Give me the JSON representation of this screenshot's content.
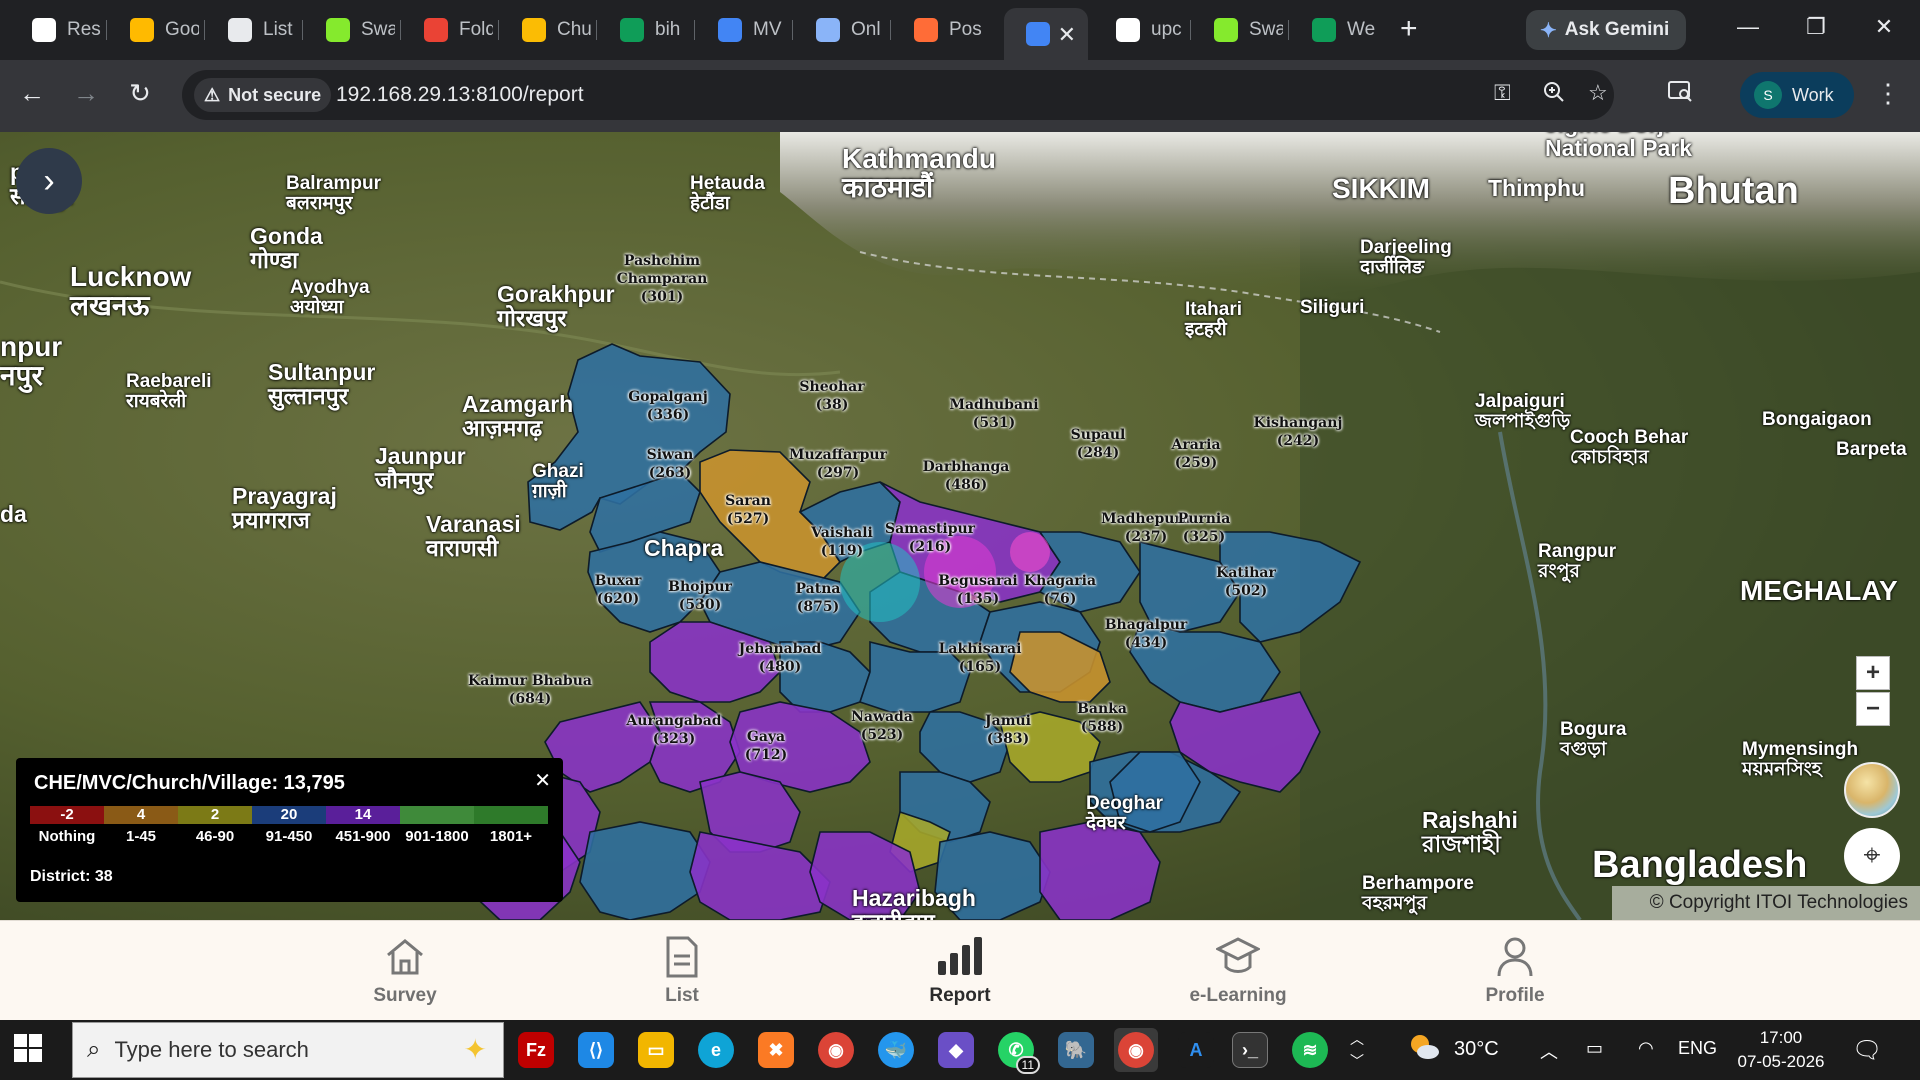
{
  "browser": {
    "tabs": [
      {
        "title": "Res",
        "icon": "openai-icon",
        "color": "#ffffff"
      },
      {
        "title": "Goo",
        "icon": "google-meet-icon",
        "color": "#ffba00"
      },
      {
        "title": "List",
        "icon": "list-app-icon",
        "color": "#e8eaed"
      },
      {
        "title": "Swa",
        "icon": "swagger-icon",
        "color": "#85ea2d"
      },
      {
        "title": "Fold",
        "icon": "gmail-icon",
        "color": "#ea4335"
      },
      {
        "title": "Chu",
        "icon": "google-drive-icon",
        "color": "#fbbc04"
      },
      {
        "title": "bih",
        "icon": "google-sheets-icon",
        "color": "#0f9d58"
      },
      {
        "title": "MV",
        "icon": "app-icon",
        "color": "#4285f4"
      },
      {
        "title": "Onl",
        "icon": "globe-icon",
        "color": "#8ab4f8"
      },
      {
        "title": "Pos",
        "icon": "postman-icon",
        "color": "#ff6c37"
      },
      {
        "title": "",
        "icon": "app-icon",
        "color": "#4285f4",
        "active": true
      },
      {
        "title": "upc",
        "icon": "github-icon",
        "color": "#ffffff"
      },
      {
        "title": "Swa",
        "icon": "swagger-icon",
        "color": "#85ea2d"
      },
      {
        "title": "We",
        "icon": "google-sheets-icon",
        "color": "#0f9d58"
      }
    ],
    "ask_gemini": "Ask Gemini",
    "not_secure": "Not secure",
    "url": "192.168.29.13:8100/report",
    "profile_initial": "S",
    "profile_label": "Work"
  },
  "map": {
    "basemap_labels": [
      {
        "text": "Kathmandu\nकाठमाडौं",
        "size": "large"
      },
      {
        "text": "Hetauda\nहेटौंडा",
        "size": "small"
      },
      {
        "text": "Balrampur\nबलरामपुर",
        "size": "small"
      },
      {
        "text": "Gonda\nगोण्डा",
        "size": "medium"
      },
      {
        "text": "Lucknow\nलखनऊ",
        "size": "large"
      },
      {
        "text": "Ayodhya\nअयोध्या",
        "size": "small"
      },
      {
        "text": "Gorakhpur\nगोरखपुर",
        "size": "medium"
      },
      {
        "text": "Raebareli\nरायबरेली",
        "size": "small"
      },
      {
        "text": "Sultanpur\nसुल्तानपुर",
        "size": "medium"
      },
      {
        "text": "Azamgarh\nआज़मगढ़",
        "size": "medium"
      },
      {
        "text": "Jaunpur\nजौनपुर",
        "size": "medium"
      },
      {
        "text": "Prayagraj\nप्रयागराज",
        "size": "medium"
      },
      {
        "text": "Varanasi\nवाराणसी",
        "size": "medium"
      },
      {
        "text": "Ghazi\nग़ाज़ी",
        "size": "small"
      },
      {
        "text": "SIKKIM",
        "size": "large"
      },
      {
        "text": "Thimphu",
        "size": "medium"
      },
      {
        "text": "Bhutan",
        "size": "xlarge"
      },
      {
        "text": "Jigme Dorji\nNational Park",
        "size": "medium"
      },
      {
        "text": "Darjeeling\nदार्जीलिङ",
        "size": "small"
      },
      {
        "text": "Itahari\nइटहरी",
        "size": "small"
      },
      {
        "text": "Siliguri",
        "size": "small"
      },
      {
        "text": "Jalpaiguri\nজলপাইগুড়ি",
        "size": "small"
      },
      {
        "text": "Cooch Behar\nকোচবিহার",
        "size": "small"
      },
      {
        "text": "Bongaigaon",
        "size": "small"
      },
      {
        "text": "Barpeta",
        "size": "small"
      },
      {
        "text": "Rangpur\nরংপুর",
        "size": "small"
      },
      {
        "text": "MEGHALAY",
        "size": "large"
      },
      {
        "text": "Bogura\nবগুড়া",
        "size": "small"
      },
      {
        "text": "Mymensingh\nময়মনসিংহ",
        "size": "small"
      },
      {
        "text": "Rajshahi\nরাজশাহী",
        "size": "medium"
      },
      {
        "text": "Bangladesh",
        "size": "xlarge"
      },
      {
        "text": "Berhampore\nবহরমপুর",
        "size": "small"
      },
      {
        "text": "Deoghar\nदेवघर",
        "size": "small"
      },
      {
        "text": "Hazaribagh\nहज़ारीबाग",
        "size": "medium"
      },
      {
        "text": "Chapra",
        "size": "medium"
      },
      {
        "text": "pur\nसीतापुर",
        "size": "medium"
      },
      {
        "text": "npur\nनपुर",
        "size": "large"
      },
      {
        "text": "da",
        "size": "medium"
      }
    ],
    "districts": [
      {
        "name": "Pashchim\nChamparan",
        "count": "(301)",
        "color": "#2f6fa0"
      },
      {
        "name": "Gopalganj",
        "count": "(336)",
        "color": "#2f6fa0"
      },
      {
        "name": "Sheohar",
        "count": "(38)",
        "color": "#c9932d"
      },
      {
        "name": "Madhubani",
        "count": "(531)",
        "color": "#8a32c8"
      },
      {
        "name": "Supaul",
        "count": "(284)",
        "color": "#2f6fa0"
      },
      {
        "name": "Araria",
        "count": "(259)",
        "color": "#2f6fa0"
      },
      {
        "name": "Kishanganj",
        "count": "(242)",
        "color": "#2f6fa0"
      },
      {
        "name": "Siwan",
        "count": "(263)",
        "color": "#2f6fa0"
      },
      {
        "name": "Muzaffarpur",
        "count": "(297)",
        "color": "#2f6fa0"
      },
      {
        "name": "Darbhanga",
        "count": "(486)",
        "color": "#2f6fa0"
      },
      {
        "name": "Saran",
        "count": "(527)",
        "color": "#8a32c8"
      },
      {
        "name": "Vaishali",
        "count": "(119)",
        "color": "#2f6fa0"
      },
      {
        "name": "Samastipur",
        "count": "(216)",
        "color": "#2f6fa0"
      },
      {
        "name": "Madhepura",
        "count": "(237)",
        "color": "#2f6fa0"
      },
      {
        "name": "Purnia",
        "count": "(325)",
        "color": "#2f6fa0"
      },
      {
        "name": "Katihar",
        "count": "(502)",
        "color": "#8a32c8"
      },
      {
        "name": "Buxar",
        "count": "(620)",
        "color": "#8a32c8"
      },
      {
        "name": "Bhojpur",
        "count": "(530)",
        "color": "#8a32c8"
      },
      {
        "name": "Patna",
        "count": "(875)",
        "color": "#8a32c8"
      },
      {
        "name": "Begusarai",
        "count": "(135)",
        "color": "#2f6fa0"
      },
      {
        "name": "Khagaria",
        "count": "(76)",
        "color": "#a7a82a"
      },
      {
        "name": "Bhagalpur",
        "count": "(434)",
        "color": "#2f6fa0"
      },
      {
        "name": "Jehanabad",
        "count": "(480)",
        "color": "#8a32c8"
      },
      {
        "name": "Lakhisarai",
        "count": "(165)",
        "color": "#2f6fa0"
      },
      {
        "name": "Kaimur Bhabua",
        "count": "(684)",
        "color": "#8a32c8"
      },
      {
        "name": "Aurangabad",
        "count": "(323)",
        "color": "#2f6fa0"
      },
      {
        "name": "Gaya",
        "count": "(712)",
        "color": "#8a32c8"
      },
      {
        "name": "Nawada",
        "count": "(523)",
        "color": "#8a32c8"
      },
      {
        "name": "Jamui",
        "count": "(383)",
        "color": "#2f6fa0"
      },
      {
        "name": "Banka",
        "count": "(588)",
        "color": "#8a32c8"
      }
    ],
    "legend": {
      "title": "CHE/MVC/Church/Village: 13,795",
      "classes": [
        {
          "count": "-2",
          "range": "Nothing",
          "color": "#8b1010"
        },
        {
          "count": "4",
          "range": "1-45",
          "color": "#8a5a16"
        },
        {
          "count": "2",
          "range": "46-90",
          "color": "#7c7a16"
        },
        {
          "count": "20",
          "range": "91-450",
          "color": "#1b3d7a"
        },
        {
          "count": "14",
          "range": "451-900",
          "color": "#5a1f9a"
        },
        {
          "count": "",
          "range": "901-1800",
          "color": "#3f8a3a"
        },
        {
          "count": "",
          "range": "1801+",
          "color": "#2e7a2a"
        }
      ],
      "footer": "District: 38"
    },
    "zoom_in": "+",
    "zoom_out": "−",
    "copyright": "© Copyright ITOI Technologies"
  },
  "app_nav": [
    {
      "label": "Survey",
      "icon": "home-icon"
    },
    {
      "label": "List",
      "icon": "document-icon"
    },
    {
      "label": "Report",
      "icon": "bar-chart-icon",
      "active": true
    },
    {
      "label": "e-Learning",
      "icon": "graduation-cap-icon"
    },
    {
      "label": "Profile",
      "icon": "user-icon"
    }
  ],
  "taskbar": {
    "search_placeholder": "Type here to search",
    "whatsapp_badge": "11",
    "weather": "30°C",
    "language": "ENG",
    "time": "17:00",
    "date": "07-05-2026"
  }
}
